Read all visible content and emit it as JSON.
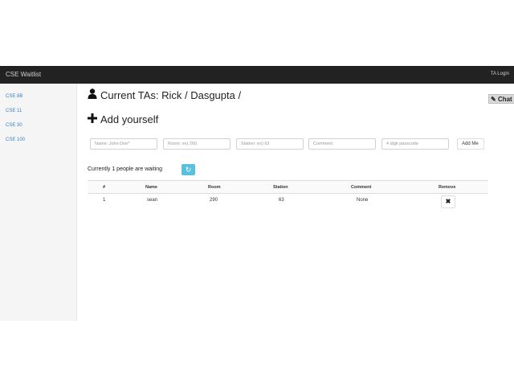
{
  "navbar": {
    "brand": "CSE Waitlist",
    "ta_login": "TA Login"
  },
  "sidebar": {
    "items": [
      {
        "label": "CSE 8B"
      },
      {
        "label": "CSE 11"
      },
      {
        "label": "CSE 30"
      },
      {
        "label": "CSE 100"
      }
    ]
  },
  "chat_button": {
    "label": "Chat",
    "icon": "pencil-icon"
  },
  "current_tas": {
    "label": "Current TAs: Rick / Dasgupta /",
    "icon": "user-icon"
  },
  "add_yourself": {
    "label": "Add yourself",
    "icon": "plus-icon"
  },
  "form": {
    "name_placeholder": "Name: John Doe*",
    "room_placeholder": "Room: ex) 260",
    "station_placeholder": "Station: ex) 63",
    "comment_placeholder": "Comment:",
    "passcode_placeholder": "4 digit passcode",
    "add_button": "Add Me"
  },
  "queue": {
    "waiting_text": "Currently 1 people are waiting",
    "refresh_icon": "refresh-icon",
    "columns": {
      "num": "#",
      "name": "Name",
      "room": "Room",
      "station": "Station",
      "comment": "Comment",
      "remove": "Remove"
    },
    "rows": [
      {
        "num": "1",
        "name": "sean",
        "room": "290",
        "station": "63",
        "comment": "None",
        "remove": "✖"
      }
    ]
  }
}
